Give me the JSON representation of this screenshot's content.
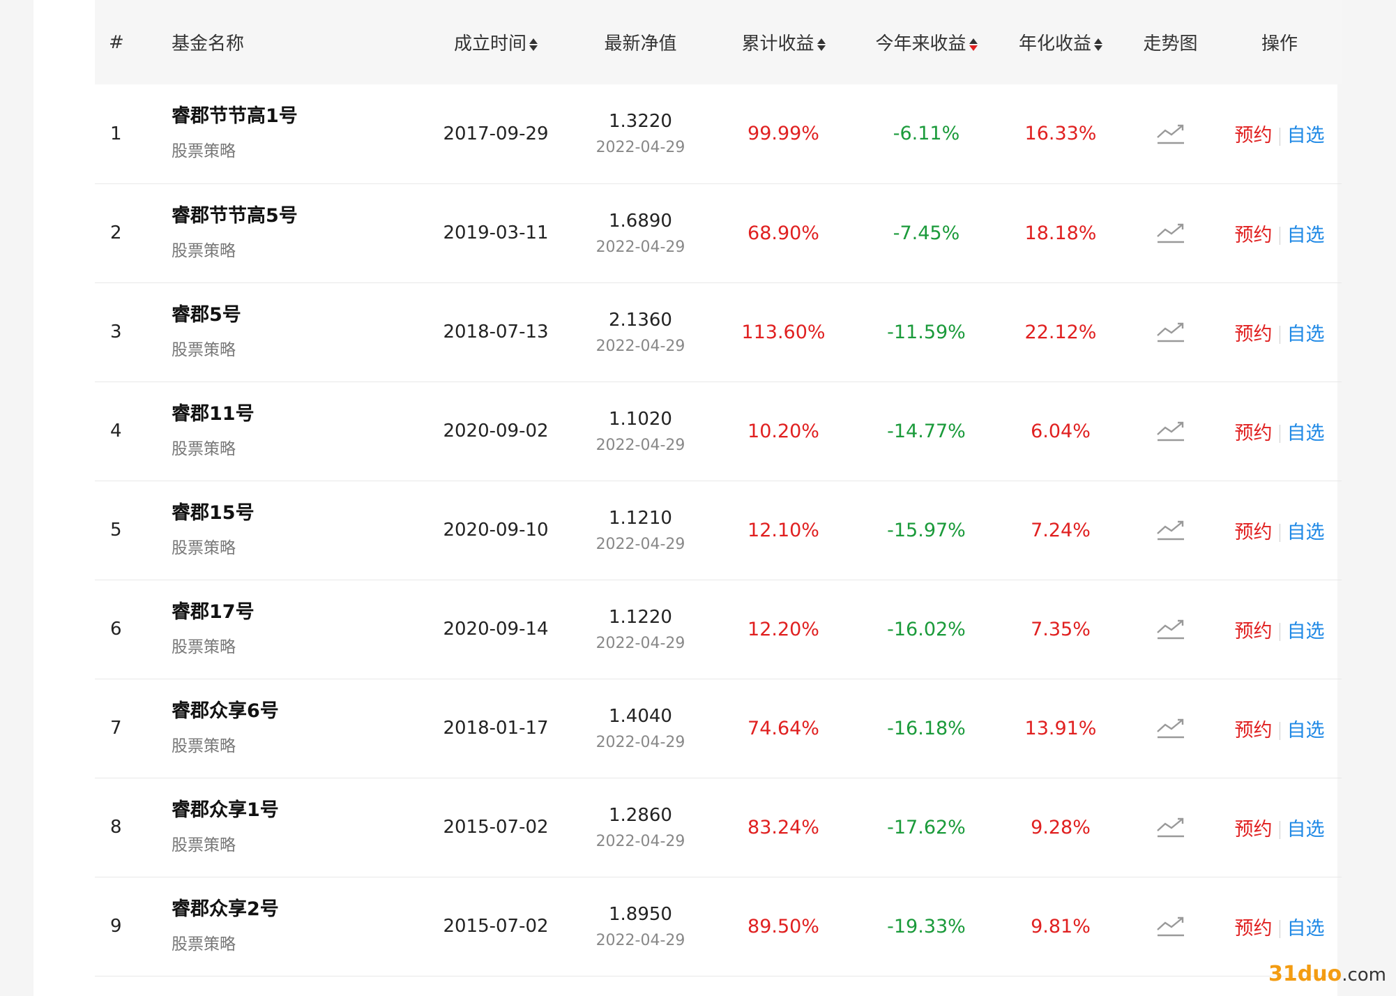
{
  "headers": {
    "index": "#",
    "name": "基金名称",
    "established": "成立时间",
    "nav": "最新净值",
    "cumulative": "累计收益",
    "ytd": "今年来收益",
    "annualized": "年化收益",
    "trend": "走势图",
    "actions": "操作"
  },
  "actions": {
    "reserve": "预约",
    "watch": "自选"
  },
  "colors": {
    "positive": "#e02020",
    "negative": "#1a9a3a",
    "link": "#1e88e5"
  },
  "rows": [
    {
      "idx": "1",
      "name": "睿郡节节高1号",
      "type": "股票策略",
      "established": "2017-09-29",
      "nav": "1.3220",
      "nav_date": "2022-04-29",
      "cumulative": "99.99%",
      "ytd": "-6.11%",
      "annualized": "16.33%"
    },
    {
      "idx": "2",
      "name": "睿郡节节高5号",
      "type": "股票策略",
      "established": "2019-03-11",
      "nav": "1.6890",
      "nav_date": "2022-04-29",
      "cumulative": "68.90%",
      "ytd": "-7.45%",
      "annualized": "18.18%"
    },
    {
      "idx": "3",
      "name": "睿郡5号",
      "type": "股票策略",
      "established": "2018-07-13",
      "nav": "2.1360",
      "nav_date": "2022-04-29",
      "cumulative": "113.60%",
      "ytd": "-11.59%",
      "annualized": "22.12%"
    },
    {
      "idx": "4",
      "name": "睿郡11号",
      "type": "股票策略",
      "established": "2020-09-02",
      "nav": "1.1020",
      "nav_date": "2022-04-29",
      "cumulative": "10.20%",
      "ytd": "-14.77%",
      "annualized": "6.04%"
    },
    {
      "idx": "5",
      "name": "睿郡15号",
      "type": "股票策略",
      "established": "2020-09-10",
      "nav": "1.1210",
      "nav_date": "2022-04-29",
      "cumulative": "12.10%",
      "ytd": "-15.97%",
      "annualized": "7.24%"
    },
    {
      "idx": "6",
      "name": "睿郡17号",
      "type": "股票策略",
      "established": "2020-09-14",
      "nav": "1.1220",
      "nav_date": "2022-04-29",
      "cumulative": "12.20%",
      "ytd": "-16.02%",
      "annualized": "7.35%"
    },
    {
      "idx": "7",
      "name": "睿郡众享6号",
      "type": "股票策略",
      "established": "2018-01-17",
      "nav": "1.4040",
      "nav_date": "2022-04-29",
      "cumulative": "74.64%",
      "ytd": "-16.18%",
      "annualized": "13.91%"
    },
    {
      "idx": "8",
      "name": "睿郡众享1号",
      "type": "股票策略",
      "established": "2015-07-02",
      "nav": "1.2860",
      "nav_date": "2022-04-29",
      "cumulative": "83.24%",
      "ytd": "-17.62%",
      "annualized": "9.28%"
    },
    {
      "idx": "9",
      "name": "睿郡众享2号",
      "type": "股票策略",
      "established": "2015-07-02",
      "nav": "1.8950",
      "nav_date": "2022-04-29",
      "cumulative": "89.50%",
      "ytd": "-19.33%",
      "annualized": "9.81%"
    }
  ],
  "watermark": {
    "brand": "31duo",
    "suffix": ".com"
  }
}
